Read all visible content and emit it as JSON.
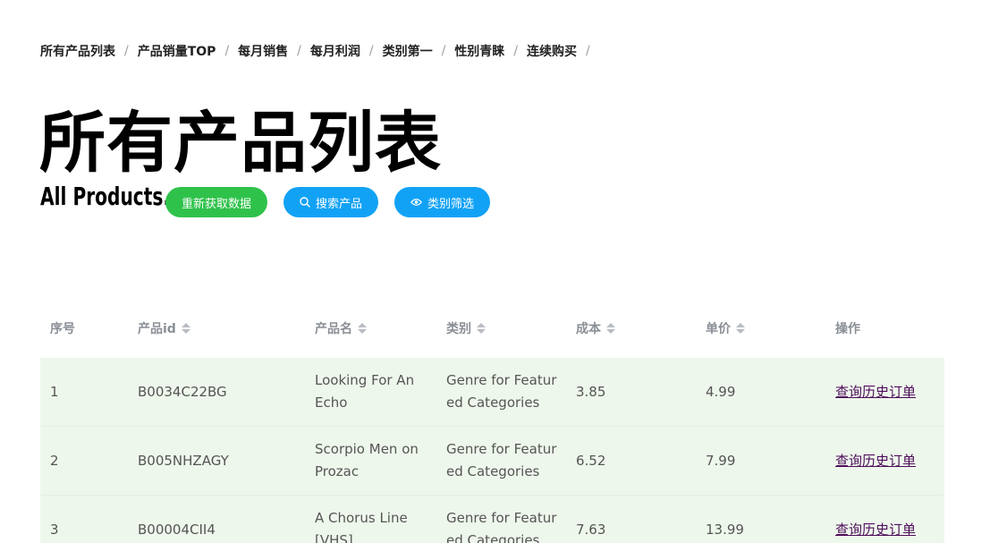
{
  "breadcrumb": [
    {
      "label": "所有产品列表"
    },
    {
      "label": "产品销量TOP"
    },
    {
      "label": "每月销售"
    },
    {
      "label": "每月利润"
    },
    {
      "label": "类别第一"
    },
    {
      "label": "性别青睐"
    },
    {
      "label": "连续购买"
    }
  ],
  "breadcrumb_separator": "/",
  "page": {
    "title": "所有产品列表",
    "subtitle": "All Products."
  },
  "buttons": {
    "refresh": "重新获取数据",
    "search": "搜索产品",
    "filter": "类别筛选"
  },
  "icons": {
    "search": "search-icon",
    "filter": "eye-icon"
  },
  "colors": {
    "refresh_button": "#2fc24b",
    "action_button": "#12a2f5",
    "row_background": "#eef7ec",
    "link": "#4d0d5a"
  },
  "table": {
    "headers": [
      "序号",
      "产品id",
      "产品名",
      "类别",
      "成本",
      "单价",
      "操作"
    ],
    "rows": [
      {
        "index": "1",
        "id": "B0034C22BG",
        "name": "Looking For An Echo",
        "category": "Genre for Featured Categories",
        "cost": "3.85",
        "price": "4.99",
        "action": "查询历史订单"
      },
      {
        "index": "2",
        "id": "B005NHZAGY",
        "name": "Scorpio Men on Prozac",
        "category": "Genre for Featured Categories",
        "cost": "6.52",
        "price": "7.99",
        "action": "查询历史订单"
      },
      {
        "index": "3",
        "id": "B00004CII4",
        "name": "A Chorus Line [VHS]",
        "category": "Genre for Featured Categories",
        "cost": "7.63",
        "price": "13.99",
        "action": "查询历史订单"
      }
    ]
  }
}
